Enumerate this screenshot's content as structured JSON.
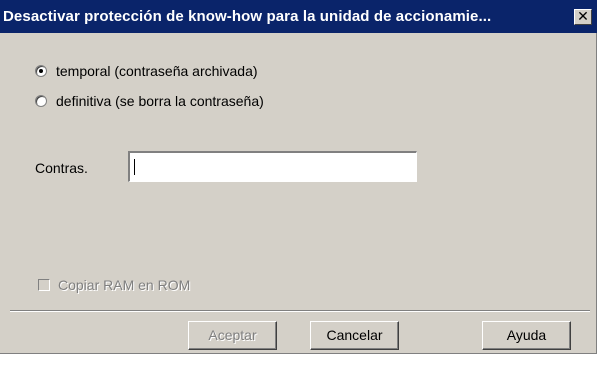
{
  "dialog": {
    "title": "Desactivar protección de know-how para la unidad de accionamie...",
    "close_glyph": "✕",
    "options": [
      {
        "label": "temporal (contraseña archivada)",
        "selected": true
      },
      {
        "label": "definitiva (se borra la contraseña)",
        "selected": false
      }
    ],
    "password_label": "Contras.",
    "password_value": "",
    "copy_ram_label": "Copiar RAM en ROM",
    "copy_ram_checked": false,
    "copy_ram_enabled": false,
    "buttons": {
      "ok": "Aceptar",
      "cancel": "Cancelar",
      "help": "Ayuda"
    }
  }
}
